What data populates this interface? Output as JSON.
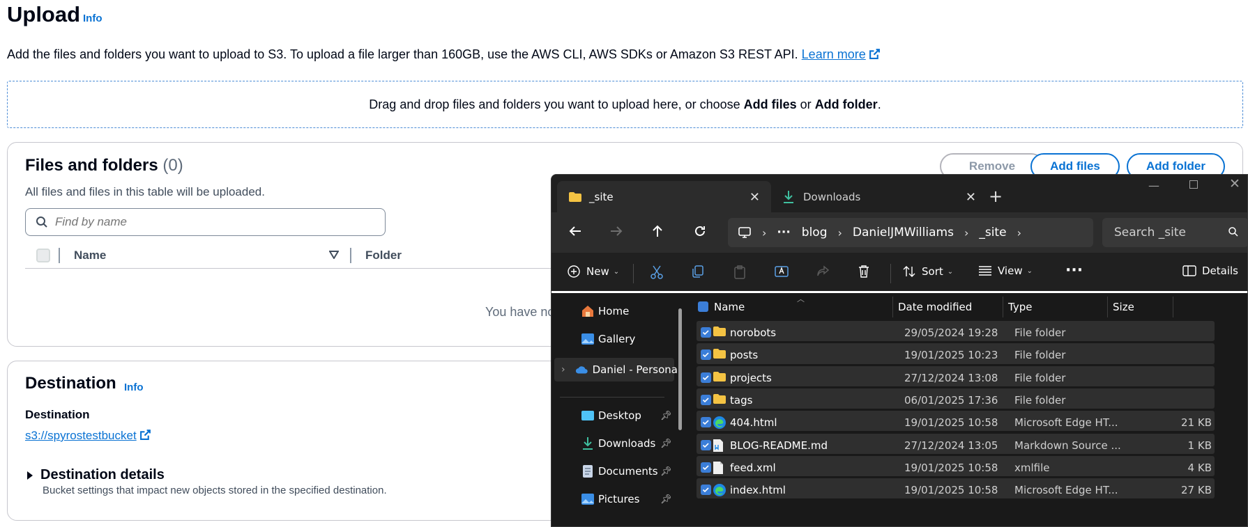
{
  "s3": {
    "title": "Upload",
    "info": "Info",
    "intro": "Add the files and folders you want to upload to S3. To upload a file larger than 160GB, use the AWS CLI, AWS SDKs or Amazon S3 REST API.",
    "learn_more": "Learn more",
    "dropzone": {
      "prefix": "Drag and drop files and folders you want to upload here, or choose ",
      "add_files": "Add files",
      "or": " or ",
      "add_folder": "Add folder",
      "suffix": "."
    },
    "files": {
      "title": "Files and folders",
      "count": "(0)",
      "description": "All files and files in this table will be uploaded.",
      "search_placeholder": "Find by name",
      "col_name": "Name",
      "col_folder": "Folder",
      "empty": "You have no",
      "btn_remove": "Remove",
      "btn_add_files": "Add files",
      "btn_add_folder": "Add folder"
    },
    "destination": {
      "title": "Destination",
      "info": "Info",
      "label": "Destination",
      "bucket": "s3://spyrostestbucket",
      "details_title": "Destination details",
      "details_desc": "Bucket settings that impact new objects stored in the specified destination."
    }
  },
  "explorer": {
    "tabs": [
      {
        "label": "_site"
      },
      {
        "label": "Downloads"
      }
    ],
    "breadcrumb": [
      "blog",
      "DanielJMWilliams",
      "_site"
    ],
    "search_placeholder": "Search _site",
    "commands": {
      "new": "New",
      "sort": "Sort",
      "view": "View",
      "details": "Details"
    },
    "nav": {
      "home": "Home",
      "gallery": "Gallery",
      "onedrive": "Daniel - Persona",
      "desktop": "Desktop",
      "downloads": "Downloads",
      "documents": "Documents",
      "pictures": "Pictures"
    },
    "columns": {
      "name": "Name",
      "date": "Date modified",
      "type": "Type",
      "size": "Size"
    },
    "files": [
      {
        "name": "norobots",
        "date": "29/05/2024 19:28",
        "type": "File folder",
        "size": "",
        "icon": "folder"
      },
      {
        "name": "posts",
        "date": "19/01/2025 10:23",
        "type": "File folder",
        "size": "",
        "icon": "folder"
      },
      {
        "name": "projects",
        "date": "27/12/2024 13:08",
        "type": "File folder",
        "size": "",
        "icon": "folder"
      },
      {
        "name": "tags",
        "date": "06/01/2025 17:36",
        "type": "File folder",
        "size": "",
        "icon": "folder"
      },
      {
        "name": "404.html",
        "date": "19/01/2025 10:58",
        "type": "Microsoft Edge HT...",
        "size": "21 KB",
        "icon": "edge"
      },
      {
        "name": "BLOG-README.md",
        "date": "27/12/2024 13:05",
        "type": "Markdown Source ...",
        "size": "1 KB",
        "icon": "markdown"
      },
      {
        "name": "feed.xml",
        "date": "19/01/2025 10:58",
        "type": "xmlfile",
        "size": "4 KB",
        "icon": "file"
      },
      {
        "name": "index.html",
        "date": "19/01/2025 10:58",
        "type": "Microsoft Edge HT...",
        "size": "27 KB",
        "icon": "edge"
      }
    ]
  }
}
